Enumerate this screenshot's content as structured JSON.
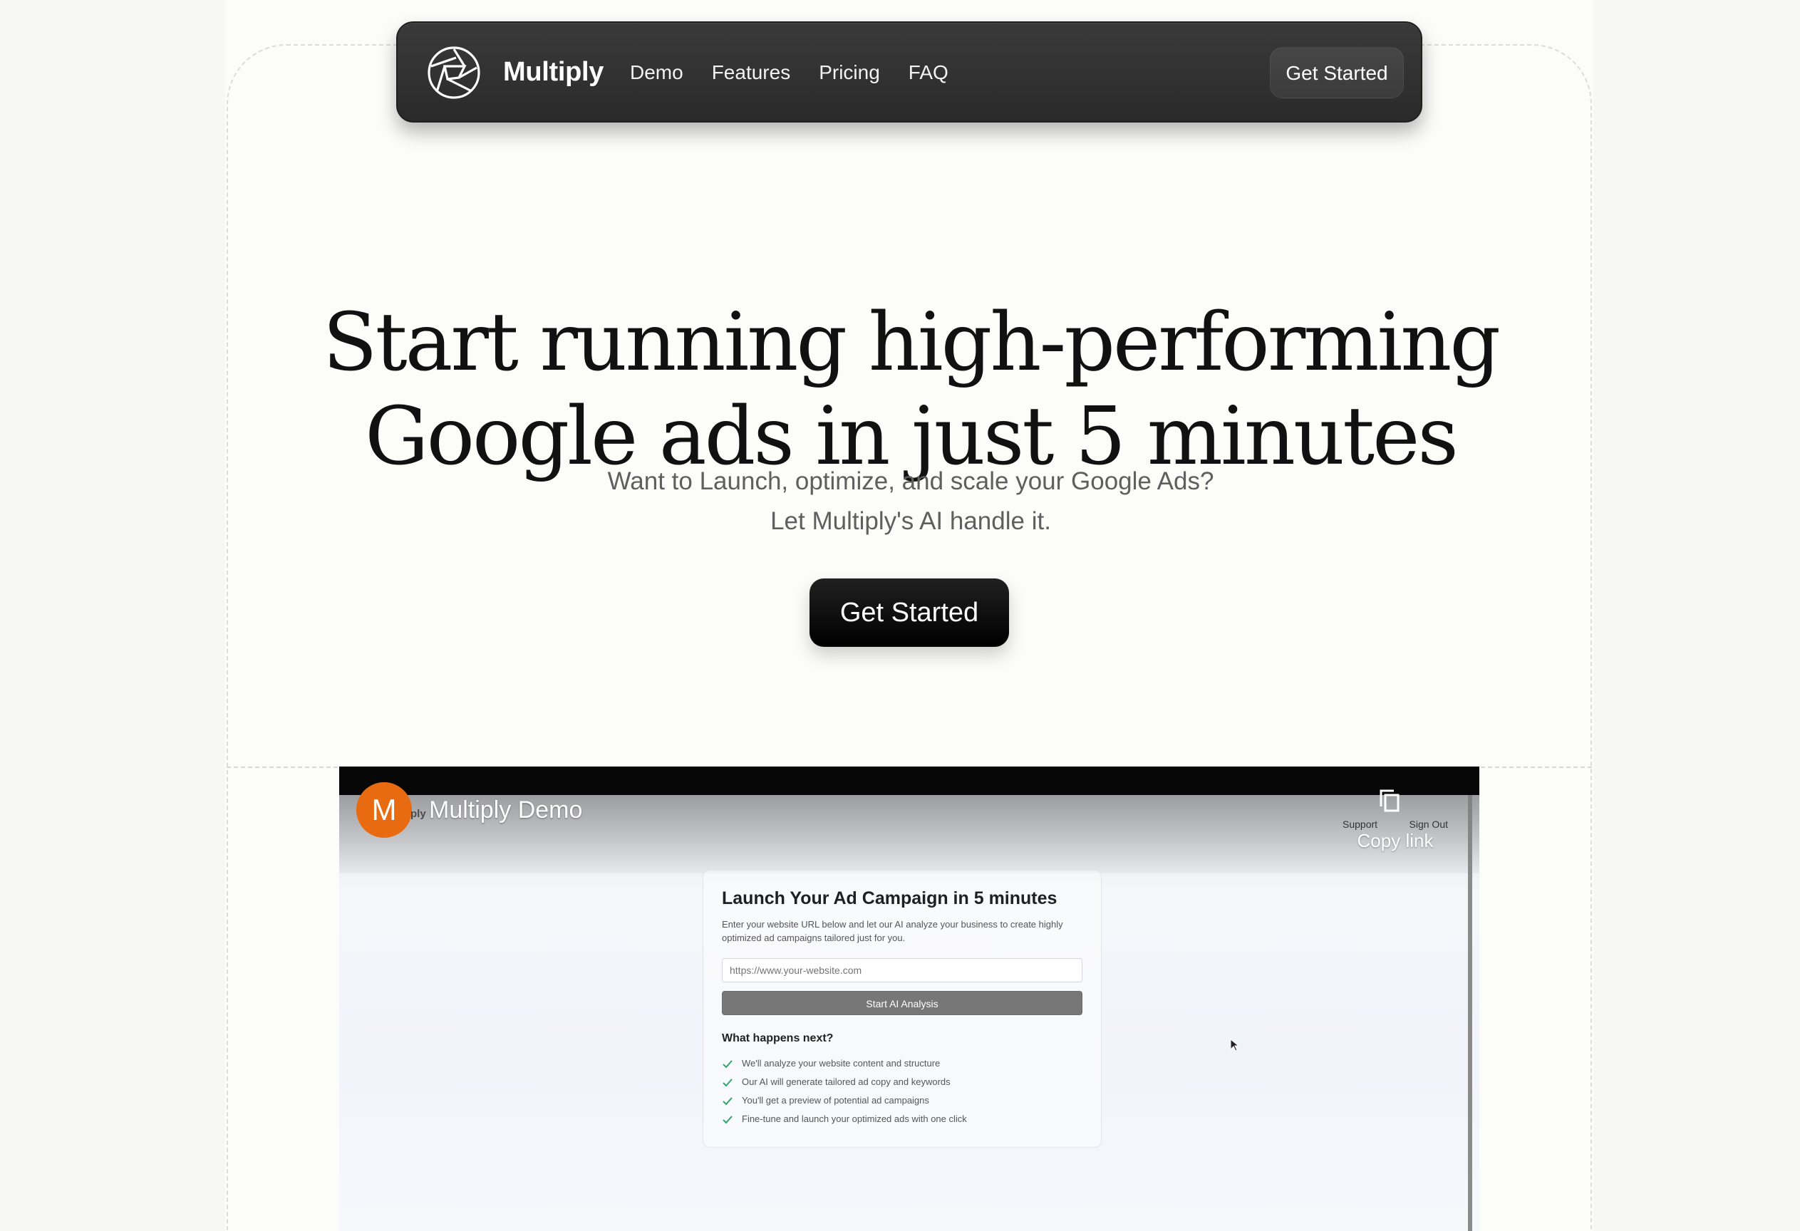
{
  "nav": {
    "brand": "Multiply",
    "links": [
      "Demo",
      "Features",
      "Pricing",
      "FAQ"
    ],
    "cta_label": "Get Started"
  },
  "hero": {
    "headline_line1": "Start running high-performing",
    "headline_line2": "Google ads in just 5 minutes",
    "subheadline_line1": "Want to Launch, optimize, and scale your Google Ads?",
    "subheadline_line2": "Let Multiply's AI handle it.",
    "cta_label": "Get Started"
  },
  "video": {
    "channel_avatar_letter": "M",
    "channel_name_partial": "ply",
    "title": "Multiply Demo",
    "support_label": "Support",
    "sign_out_label": "Sign Out",
    "copy_link_label": "Copy link",
    "card": {
      "title": "Launch Your Ad Campaign in 5 minutes",
      "description": "Enter your website URL below and let our AI analyze your business to create highly optimized ad campaigns tailored just for you.",
      "url_placeholder": "https://www.your-website.com",
      "analysis_button_label": "Start AI Analysis",
      "next_heading": "What happens next?",
      "steps": [
        "We'll analyze your website content and structure",
        "Our AI will generate tailored ad copy and keywords",
        "You'll get a preview of potential ad campaigns",
        "Fine-tune and launch your optimized ads with one click"
      ]
    },
    "icons": {
      "copy": "copy-icon",
      "check": "check-icon",
      "cursor": "cursor-icon",
      "logo": "aperture-logo-icon"
    }
  },
  "colors": {
    "nav_background": "#2f2f2f",
    "hero_text": "#111111",
    "subhead_text": "#5f5f5f",
    "accent_orange": "#e86b11",
    "success_green": "#33a36d"
  }
}
